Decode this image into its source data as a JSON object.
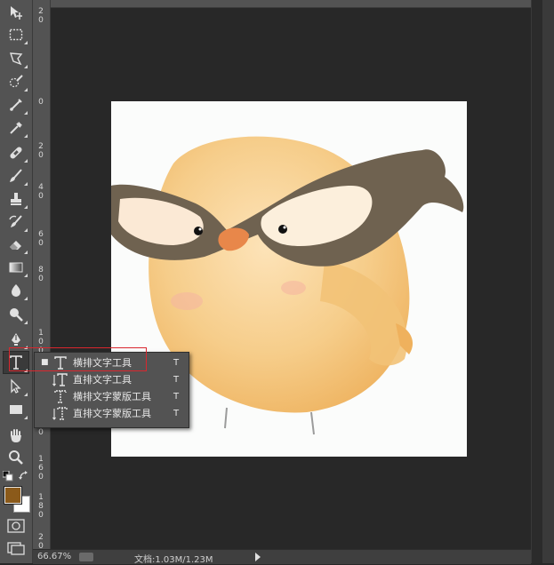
{
  "toolbar": {
    "tools": [
      {
        "name": "move-tool",
        "icon": "move-icon"
      },
      {
        "name": "marquee-tool",
        "icon": "rect-marquee-icon"
      },
      {
        "name": "lasso-tool",
        "icon": "lasso-icon"
      },
      {
        "name": "quick-select-tool",
        "icon": "quick-select-icon"
      },
      {
        "name": "crop-tool",
        "icon": "crop-icon"
      },
      {
        "name": "eyedropper-tool",
        "icon": "eyedropper-icon"
      },
      {
        "name": "healing-tool",
        "icon": "bandage-icon"
      },
      {
        "name": "brush-tool",
        "icon": "brush-icon"
      },
      {
        "name": "stamp-tool",
        "icon": "stamp-icon"
      },
      {
        "name": "history-brush-tool",
        "icon": "history-brush-icon"
      },
      {
        "name": "eraser-tool",
        "icon": "eraser-icon"
      },
      {
        "name": "gradient-tool",
        "icon": "gradient-icon"
      },
      {
        "name": "blur-tool",
        "icon": "blur-icon"
      },
      {
        "name": "dodge-tool",
        "icon": "dodge-icon"
      },
      {
        "name": "pen-tool",
        "icon": "pen-icon"
      },
      {
        "name": "type-tool",
        "icon": "type-icon"
      },
      {
        "name": "path-select-tool",
        "icon": "path-select-icon"
      },
      {
        "name": "shape-tool",
        "icon": "rectangle-icon"
      },
      {
        "name": "hand-tool",
        "icon": "hand-icon"
      },
      {
        "name": "zoom-tool",
        "icon": "zoom-icon"
      }
    ]
  },
  "ruler": {
    "vertical_marks": [
      {
        "digits": [
          "2",
          "0"
        ]
      },
      {
        "digits": [
          "0"
        ]
      },
      {
        "digits": [
          "2",
          "0"
        ]
      },
      {
        "digits": [
          "4",
          "0"
        ]
      },
      {
        "digits": [
          "6",
          "0"
        ]
      },
      {
        "digits": [
          "8",
          "0"
        ]
      },
      {
        "digits": [
          "1",
          "0",
          "0"
        ]
      },
      {
        "digits": [
          "1",
          "2",
          "0"
        ]
      },
      {
        "digits": [
          "1",
          "4",
          "0"
        ]
      },
      {
        "digits": [
          "1",
          "6",
          "0"
        ]
      },
      {
        "digits": [
          "1",
          "8",
          "0"
        ]
      },
      {
        "digits": [
          "2",
          "0",
          "0"
        ]
      }
    ]
  },
  "flyout": {
    "items": [
      {
        "label": "横排文字工具",
        "shortcut": "T",
        "selected": true,
        "icon": "horizontal-type-icon"
      },
      {
        "label": "直排文字工具",
        "shortcut": "T",
        "selected": false,
        "icon": "vertical-type-icon"
      },
      {
        "label": "横排文字蒙版工具",
        "shortcut": "T",
        "selected": false,
        "icon": "horizontal-type-mask-icon"
      },
      {
        "label": "直排文字蒙版工具",
        "shortcut": "T",
        "selected": false,
        "icon": "vertical-type-mask-icon"
      }
    ],
    "bullet": "■"
  },
  "colors": {
    "foreground": "#8b5a1a",
    "background": "#ffffff",
    "highlight": "#d9272e"
  },
  "status": {
    "zoom": "66.67%",
    "doc": "文档:1.03M/1.23M"
  }
}
